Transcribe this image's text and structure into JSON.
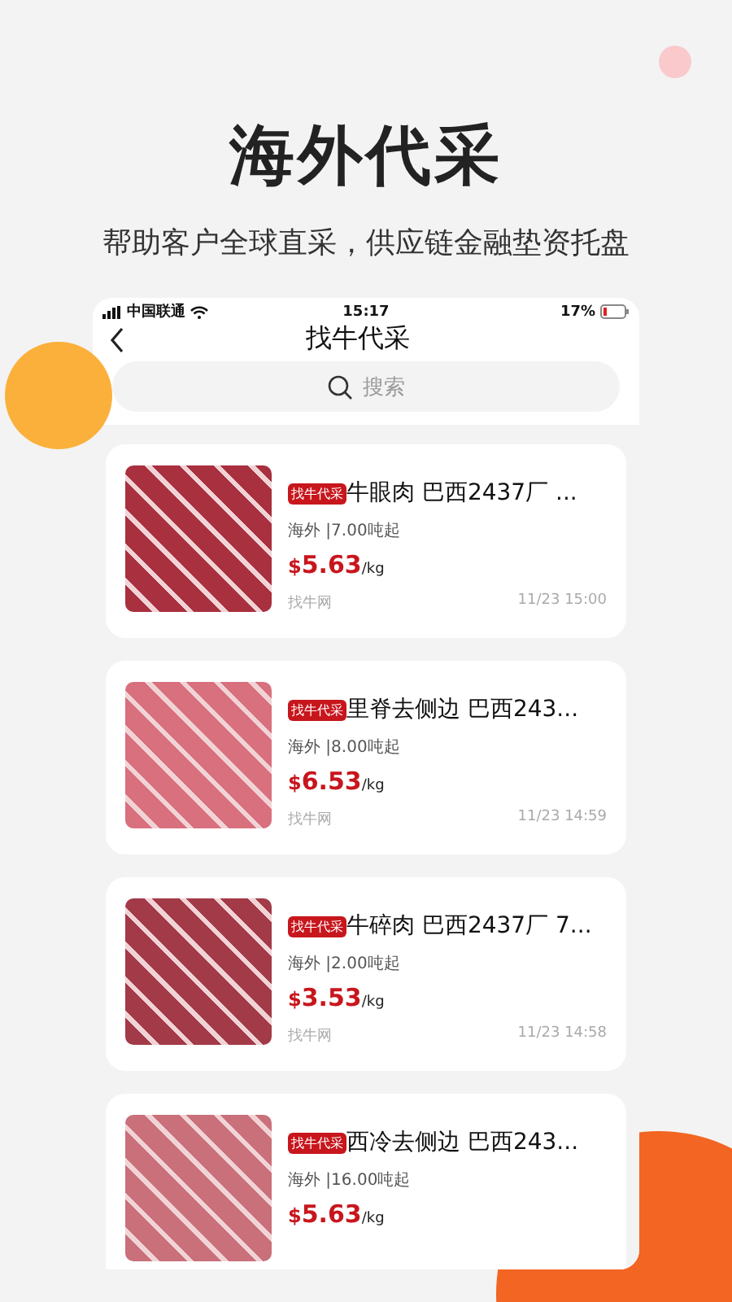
{
  "headline": "海外代采",
  "subheadline": "帮助客户全球直采，供应链金融垫资托盘",
  "status_bar": {
    "carrier": "中国联通",
    "time": "15:17",
    "battery": "17%"
  },
  "nav": {
    "title": "找牛代采"
  },
  "search": {
    "placeholder": "搜索"
  },
  "products": [
    {
      "tag": "找牛代采",
      "title": "牛眼肉 巴西2437厂 ...",
      "origin": "海外 |7.00吨起",
      "currency": "$",
      "price": "5.63",
      "unit": "/kg",
      "source": "找牛网",
      "time": "11/23 15:00"
    },
    {
      "tag": "找牛代采",
      "title": "里脊去侧边 巴西243...",
      "origin": "海外 |8.00吨起",
      "currency": "$",
      "price": "6.53",
      "unit": "/kg",
      "source": "找牛网",
      "time": "11/23 14:59"
    },
    {
      "tag": "找牛代采",
      "title": "牛碎肉 巴西2437厂 7...",
      "origin": "海外 |2.00吨起",
      "currency": "$",
      "price": "3.53",
      "unit": "/kg",
      "source": "找牛网",
      "time": "11/23 14:58"
    },
    {
      "tag": "找牛代采",
      "title": "西冷去侧边 巴西243...",
      "origin": "海外 |16.00吨起",
      "currency": "$",
      "price": "5.63",
      "unit": "/kg"
    }
  ]
}
